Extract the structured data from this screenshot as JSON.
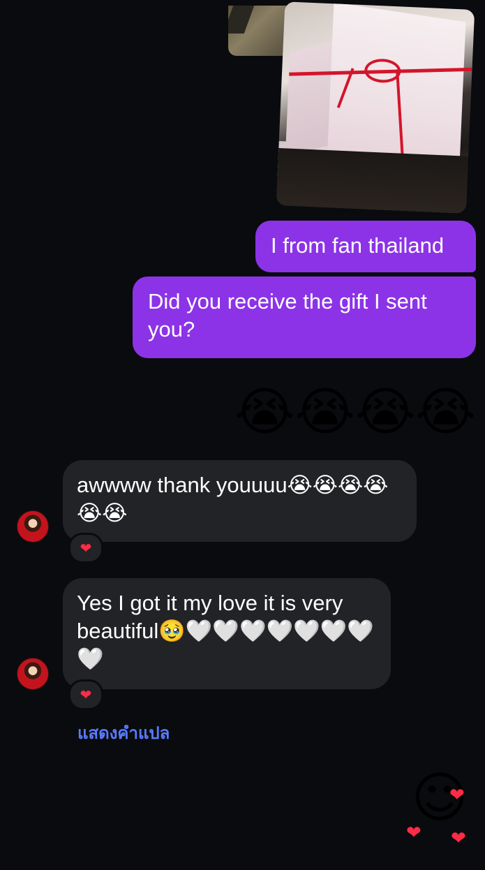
{
  "thread": {
    "messages": [
      {
        "sender": "me",
        "type": "photo",
        "description": "gift box photo"
      },
      {
        "sender": "me",
        "type": "text",
        "text": "I from fan thailand"
      },
      {
        "sender": "me",
        "type": "text",
        "text": "Did you receive the gift I sent you?"
      },
      {
        "sender": "me",
        "type": "emoji",
        "text": "😭😭😭😭"
      },
      {
        "sender": "them",
        "type": "text",
        "text": "awwww thank youuuu😭😭😭😭😭😭",
        "reaction": "❤"
      },
      {
        "sender": "them",
        "type": "text",
        "text": "Yes I got it my love it is very beautiful🥹🤍🤍🤍🤍🤍🤍🤍🤍",
        "reaction": "❤"
      }
    ],
    "translate_label": "แสดงคำแปล",
    "sticker": "☺",
    "sticker_hearts": [
      "❤",
      "❤",
      "❤"
    ]
  },
  "colors": {
    "background": "#0a0b0f",
    "outgoing_bubble": "#8c33e8",
    "incoming_bubble": "#222326",
    "link": "#5a7bff",
    "heart": "#ff2b44"
  }
}
